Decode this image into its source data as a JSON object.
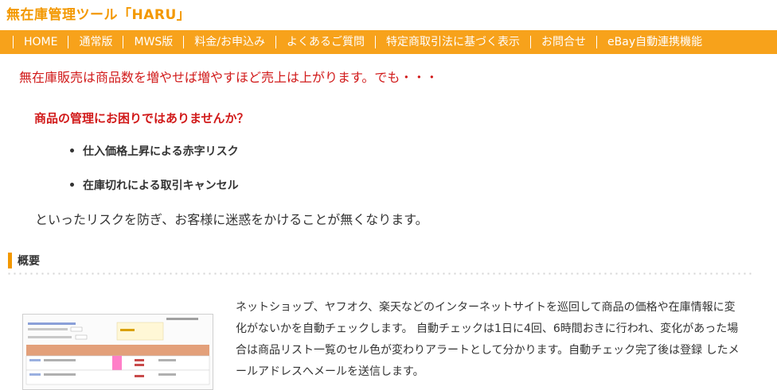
{
  "site": {
    "title": "無在庫管理ツール「HARU」"
  },
  "nav": {
    "items": [
      "HOME",
      "通常版",
      "MWS版",
      "料金/お申込み",
      "よくあるご質問",
      "特定商取引法に基づく表示",
      "お問合せ",
      "eBay自動連携機能"
    ]
  },
  "content": {
    "lead": "無在庫販売は商品数を増やせば増やすほど売上は上がります。でも・・・",
    "question": "商品の管理にお困りではありませんか？",
    "risks": [
      "仕入価格上昇による赤字リスク",
      "在庫切れによる取引キャンセル"
    ],
    "conclusion": "といったリスクを防ぎ、お客様に迷惑をかけることが無くなります。"
  },
  "overview": {
    "heading": "概要",
    "description": "ネットショップ、ヤフオク、楽天などのインターネットサイトを巡回して商品の価格や在庫情報に変化がないかを自動チェックします。 自動チェックは1日に4回、6時間おきに行われ、変化があった場合は商品リスト一覧のセル色が変わりアラートとして分かります。自動チェック完了後は登録 したメールアドレスへメールを送信します。"
  },
  "colors": {
    "brand": "#f39800",
    "nav_bg": "#f7a21b",
    "alert_red": "#d11a1a"
  }
}
